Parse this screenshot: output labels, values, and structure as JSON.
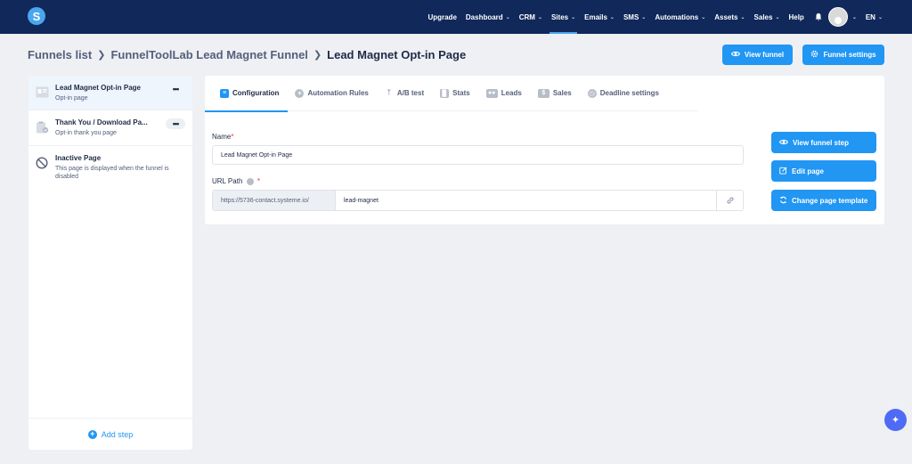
{
  "app": {
    "logo_letter": "S"
  },
  "nav": {
    "items": [
      {
        "label": "Upgrade",
        "chevron": false
      },
      {
        "label": "Dashboard",
        "chevron": true
      },
      {
        "label": "CRM",
        "chevron": true
      },
      {
        "label": "Sites",
        "chevron": true
      },
      {
        "label": "Emails",
        "chevron": true
      },
      {
        "label": "SMS",
        "chevron": true
      },
      {
        "label": "Automations",
        "chevron": true
      },
      {
        "label": "Assets",
        "chevron": true
      },
      {
        "label": "Sales",
        "chevron": true
      },
      {
        "label": "Help",
        "chevron": false
      }
    ],
    "language": "EN"
  },
  "breadcrumb": {
    "funnels_list": "Funnels list",
    "funnel_name": "FunnelToolLab Lead Magnet Funnel",
    "current_page": "Lead Magnet Opt-in Page"
  },
  "header_actions": {
    "view_funnel": "View funnel",
    "funnel_settings": "Funnel settings"
  },
  "steps": [
    {
      "title": "Lead Magnet Opt-in Page",
      "subtitle": "Opt-in page"
    },
    {
      "title": "Thank You / Download Pa...",
      "subtitle": "Opt-in thank you page"
    },
    {
      "title": "Inactive Page",
      "subtitle": "This page is displayed when the funnel is disabled"
    }
  ],
  "add_step": "Add step",
  "tabs": [
    {
      "label": "Configuration",
      "icon": "sliders-icon"
    },
    {
      "label": "Automation Rules",
      "icon": "lightning-icon"
    },
    {
      "label": "A/B test",
      "icon": "split-icon"
    },
    {
      "label": "Stats",
      "icon": "bar-chart-icon"
    },
    {
      "label": "Leads",
      "icon": "users-icon"
    },
    {
      "label": "Sales",
      "icon": "dollar-icon"
    },
    {
      "label": "Deadline settings",
      "icon": "clock-icon"
    }
  ],
  "form": {
    "name_label": "Name",
    "name_required": "*",
    "name_value": "Lead Magnet Opt-in Page",
    "url_label": "URL Path",
    "url_required": "*",
    "url_prefix": "https://5736-contact.systeme.io/",
    "url_value": "lead-magnet"
  },
  "side_actions": {
    "view_funnel_step": "View funnel step",
    "edit_page": "Edit page",
    "change_page_template": "Change page template"
  },
  "colors": {
    "nav_bg": "#10285a",
    "accent": "#2196f3",
    "page_bg": "#eef0f4"
  }
}
